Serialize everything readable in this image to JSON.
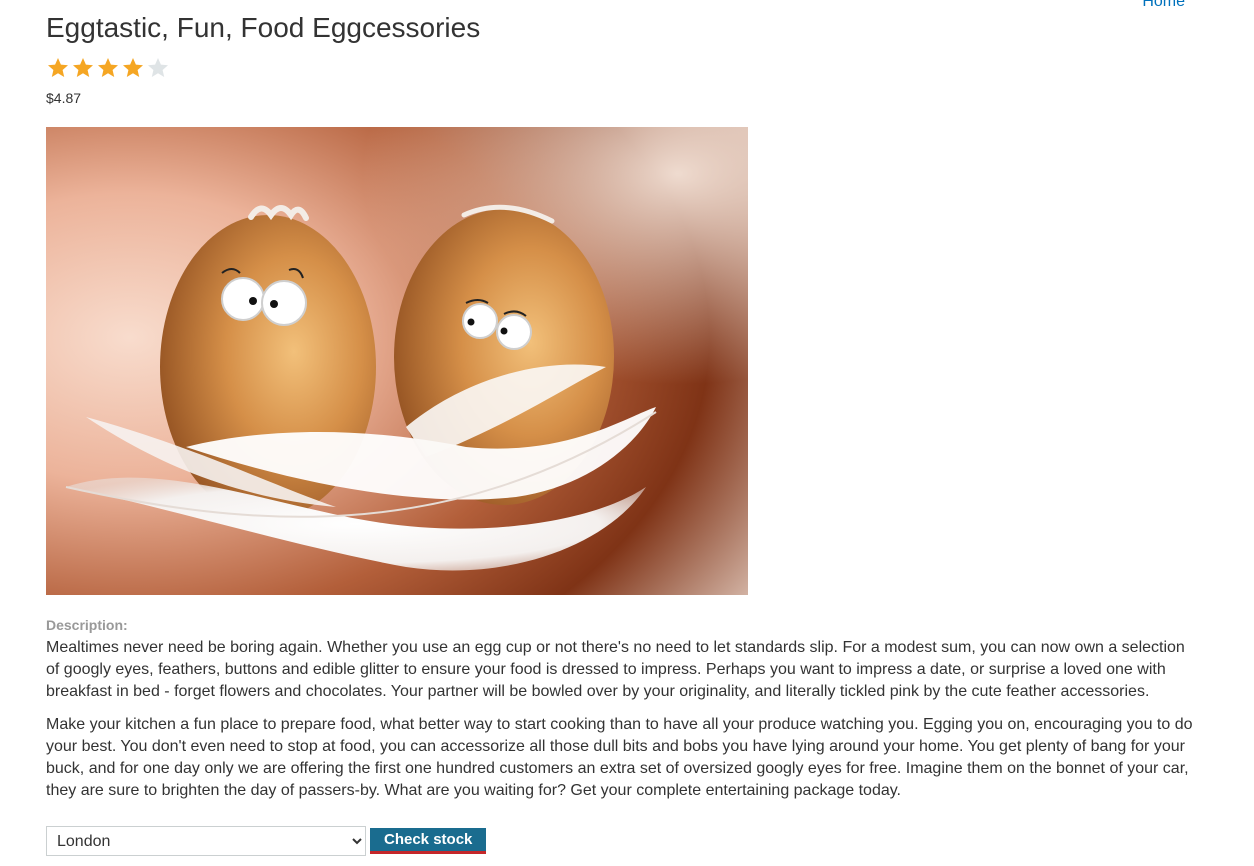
{
  "nav": {
    "home_label": "Home"
  },
  "product": {
    "title": "Eggtastic, Fun, Food Eggcessories",
    "rating": {
      "value": 4,
      "max": 5
    },
    "price": "$4.87",
    "image_icon": "egg-couple-image",
    "description_label": "Description:",
    "description": [
      "Mealtimes never need be boring again. Whether you use an egg cup or not there's no need to let standards slip. For a modest sum, you can now own a selection of googly eyes, feathers, buttons and edible glitter to ensure your food is dressed to impress. Perhaps you want to impress a date, or surprise a loved one with breakfast in bed - forget flowers and chocolates. Your partner will be bowled over by your originality, and literally tickled pink by the cute feather accessories.",
      "Make your kitchen a fun place to prepare food, what better way to start cooking than to have all your produce watching you. Egging you on, encouraging you to do your best. You don't even need to stop at food, you can accessorize all those dull bits and bobs you have lying around your home. You get plenty of bang for your buck, and for one day only we are offering the first one hundred customers an extra set of oversized googly eyes for free. Imagine them on the bonnet of your car, they are sure to brighten the day of passers-by. What are you waiting for? Get your complete entertaining package today."
    ]
  },
  "stock": {
    "selected_store": "London",
    "button_label": "Check stock"
  },
  "colors": {
    "link": "#0071bc",
    "star_filled": "#f5a623",
    "star_empty": "#dfe4e6",
    "button_bg": "#1a6c8f",
    "button_border": "#c4272a"
  }
}
